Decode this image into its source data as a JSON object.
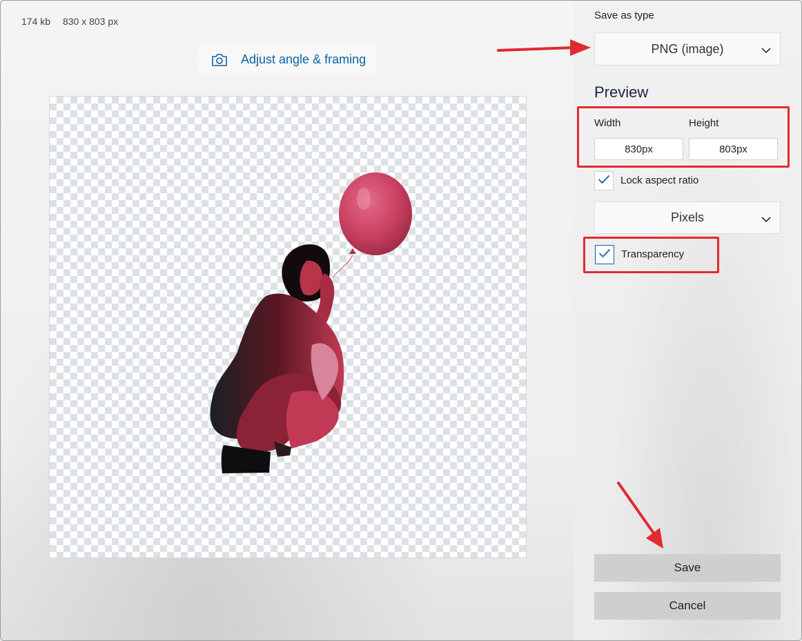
{
  "file_info": {
    "size": "174 kb",
    "dimensions": "830 x 803 px"
  },
  "adjust_button": {
    "label": "Adjust angle & framing",
    "icon": "camera-icon"
  },
  "save_as_type": {
    "label": "Save as type",
    "value": "PNG (image)"
  },
  "preview": {
    "heading": "Preview",
    "width_label": "Width",
    "height_label": "Height",
    "width_value": "830px",
    "height_value": "803px",
    "lock_aspect_label": "Lock aspect ratio",
    "lock_aspect_checked": true,
    "units_value": "Pixels",
    "transparency_label": "Transparency",
    "transparency_checked": true
  },
  "actions": {
    "save_label": "Save",
    "cancel_label": "Cancel"
  },
  "colors": {
    "accent": "#0a63a8",
    "annotation_red": "#e02a2f",
    "button_gray": "#cfcfcf",
    "checker_gray": "#dde1e6"
  }
}
